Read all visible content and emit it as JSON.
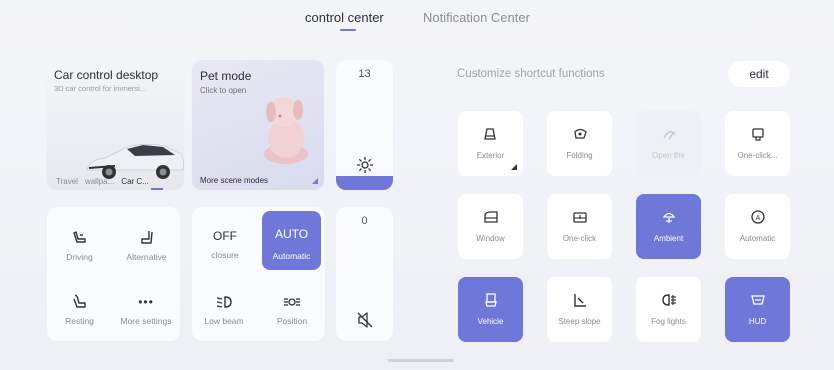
{
  "tabs": {
    "control_center": "control center",
    "notification_center": "Notification Center"
  },
  "car_card": {
    "title": "Car control desktop",
    "subtitle": "3D car control for immersi...",
    "tabs": [
      "Travel",
      "wallpa...",
      "Car C..."
    ]
  },
  "pet_card": {
    "title": "Pet mode",
    "subtitle": "Click to open",
    "footer": "More scene modes"
  },
  "brightness": {
    "value": "13",
    "level": 0.11,
    "icon": "sun-icon"
  },
  "seat": {
    "items": [
      {
        "label": "Driving",
        "icon": "seat-driving-icon"
      },
      {
        "label": "Alternative",
        "icon": "seat-alternative-icon"
      },
      {
        "label": "Resting",
        "icon": "seat-resting-icon"
      },
      {
        "label": "More settings",
        "icon": "more-icon",
        "glyph": "•••"
      }
    ]
  },
  "lights": {
    "off_label": "OFF",
    "closure_label": "closure",
    "auto_label": "AUTO",
    "automatic_label": "Automatic",
    "low_beam": "Low beam",
    "position": "Position"
  },
  "volume": {
    "value": "0",
    "icon": "mute-icon"
  },
  "shortcuts": {
    "title": "Customize shortcut functions",
    "edit": "edit",
    "tiles": [
      {
        "label": "Exterior",
        "icon": "exterior-icon",
        "state": "normal"
      },
      {
        "label": "Folding",
        "icon": "mirror-fold-icon",
        "state": "normal"
      },
      {
        "label": "Open the",
        "icon": "wiper-icon",
        "state": "disabled"
      },
      {
        "label": "One-click...",
        "icon": "one-click-icon",
        "state": "normal"
      },
      {
        "label": "Window",
        "icon": "window-icon",
        "state": "normal"
      },
      {
        "label": "One-click",
        "icon": "one-click-window-icon",
        "state": "normal"
      },
      {
        "label": "Ambient",
        "icon": "ambient-light-icon",
        "state": "active"
      },
      {
        "label": "Automatic",
        "icon": "auto-wiper-icon",
        "state": "normal"
      },
      {
        "label": "Vehicle",
        "icon": "vehicle-seat-icon",
        "state": "active"
      },
      {
        "label": "Steep slope",
        "icon": "steep-slope-icon",
        "state": "normal"
      },
      {
        "label": "Fog lights",
        "icon": "fog-lights-icon",
        "state": "normal"
      },
      {
        "label": "HUD",
        "icon": "hud-icon",
        "state": "active"
      }
    ]
  },
  "colors": {
    "accent": "#6f78d8",
    "background": "#f1f2f6",
    "tile": "#ffffff"
  }
}
